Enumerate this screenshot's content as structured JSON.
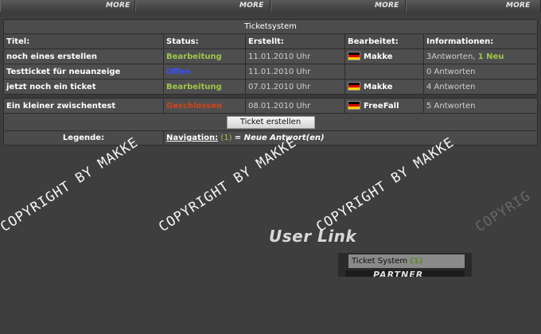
{
  "more_bar": {
    "labels": [
      "MORE",
      "MORE",
      "MORE",
      "MORE"
    ]
  },
  "ticket_system": {
    "title": "Ticketsystem",
    "columns": [
      "Titel:",
      "Status:",
      "Erstellt:",
      "Bearbeitet:",
      "Informationen:"
    ],
    "rows": [
      {
        "title": "noch eines erstellen",
        "status": "Bearbeitung",
        "status_color": "#9ec74a",
        "created": "11.01.2010 Uhr",
        "editor": "Makke",
        "info_prefix": "3Antworten, ",
        "info_new": "1 Neu"
      },
      {
        "title": "Testticket für neuanzeige",
        "status": "Offen",
        "status_color": "#3a4fff",
        "created": "11.01.2010 Uhr",
        "editor": "",
        "info_prefix": "0 Antworten",
        "info_new": ""
      },
      {
        "title": "jetzt noch ein ticket",
        "status": "Bearbeitung",
        "status_color": "#9ec74a",
        "created": "07.01.2010 Uhr",
        "editor": "Makke",
        "info_prefix": "4 Antworten",
        "info_new": ""
      },
      {
        "title": "Ein kleiner zwischentest",
        "status": "Geschlossen",
        "status_color": "#d2451a",
        "created": "08.01.2010 Uhr",
        "editor": "FreeFall",
        "info_prefix": "5 Antworten",
        "info_new": ""
      }
    ],
    "create_button": "Ticket erstellen",
    "legend_label": "Legende:",
    "legend_nav_link": "Navigation:",
    "legend_count": "(1)",
    "legend_text": "= Neue Antwort(en)"
  },
  "watermark_text": "COPYRIGHT BY MAKKE",
  "watermark_fragment": "COPYRIG",
  "user_link": {
    "title": "User Link",
    "item_label": "Ticket System",
    "item_count": "(1)",
    "partner_text": "PARTNER"
  },
  "colors": {
    "background": "#3e3e3e",
    "status_processing": "#9ec74a",
    "status_open": "#3a4fff",
    "status_closed": "#d2451a"
  },
  "icons": {
    "editor_flag": "german-flag-icon"
  }
}
